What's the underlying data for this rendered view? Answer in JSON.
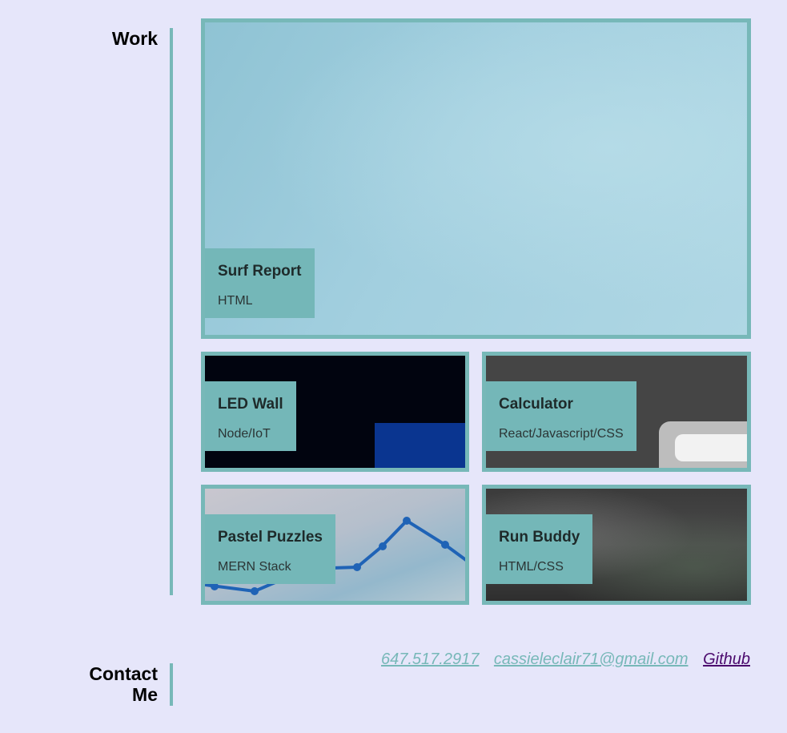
{
  "sections": {
    "work_title": "Work",
    "contact_title_line1": "Contact",
    "contact_title_line2": "Me"
  },
  "projects": [
    {
      "title": "Surf Report",
      "tech": "HTML"
    },
    {
      "title": "LED Wall",
      "tech": "Node/IoT"
    },
    {
      "title": "Calculator",
      "tech": "React/Javascript/CSS"
    },
    {
      "title": "Pastel Puzzles",
      "tech": "MERN Stack"
    },
    {
      "title": "Run Buddy",
      "tech": "HTML/CSS"
    }
  ],
  "contact": {
    "phone": "647.517.2917",
    "email": "cassieleclair71@gmail.com",
    "github": "Github"
  },
  "colors": {
    "background": "#e6e6fa",
    "accent": "#77b8b8",
    "label_bg": "#74b7b8",
    "visited_link": "#4b0a6d"
  }
}
